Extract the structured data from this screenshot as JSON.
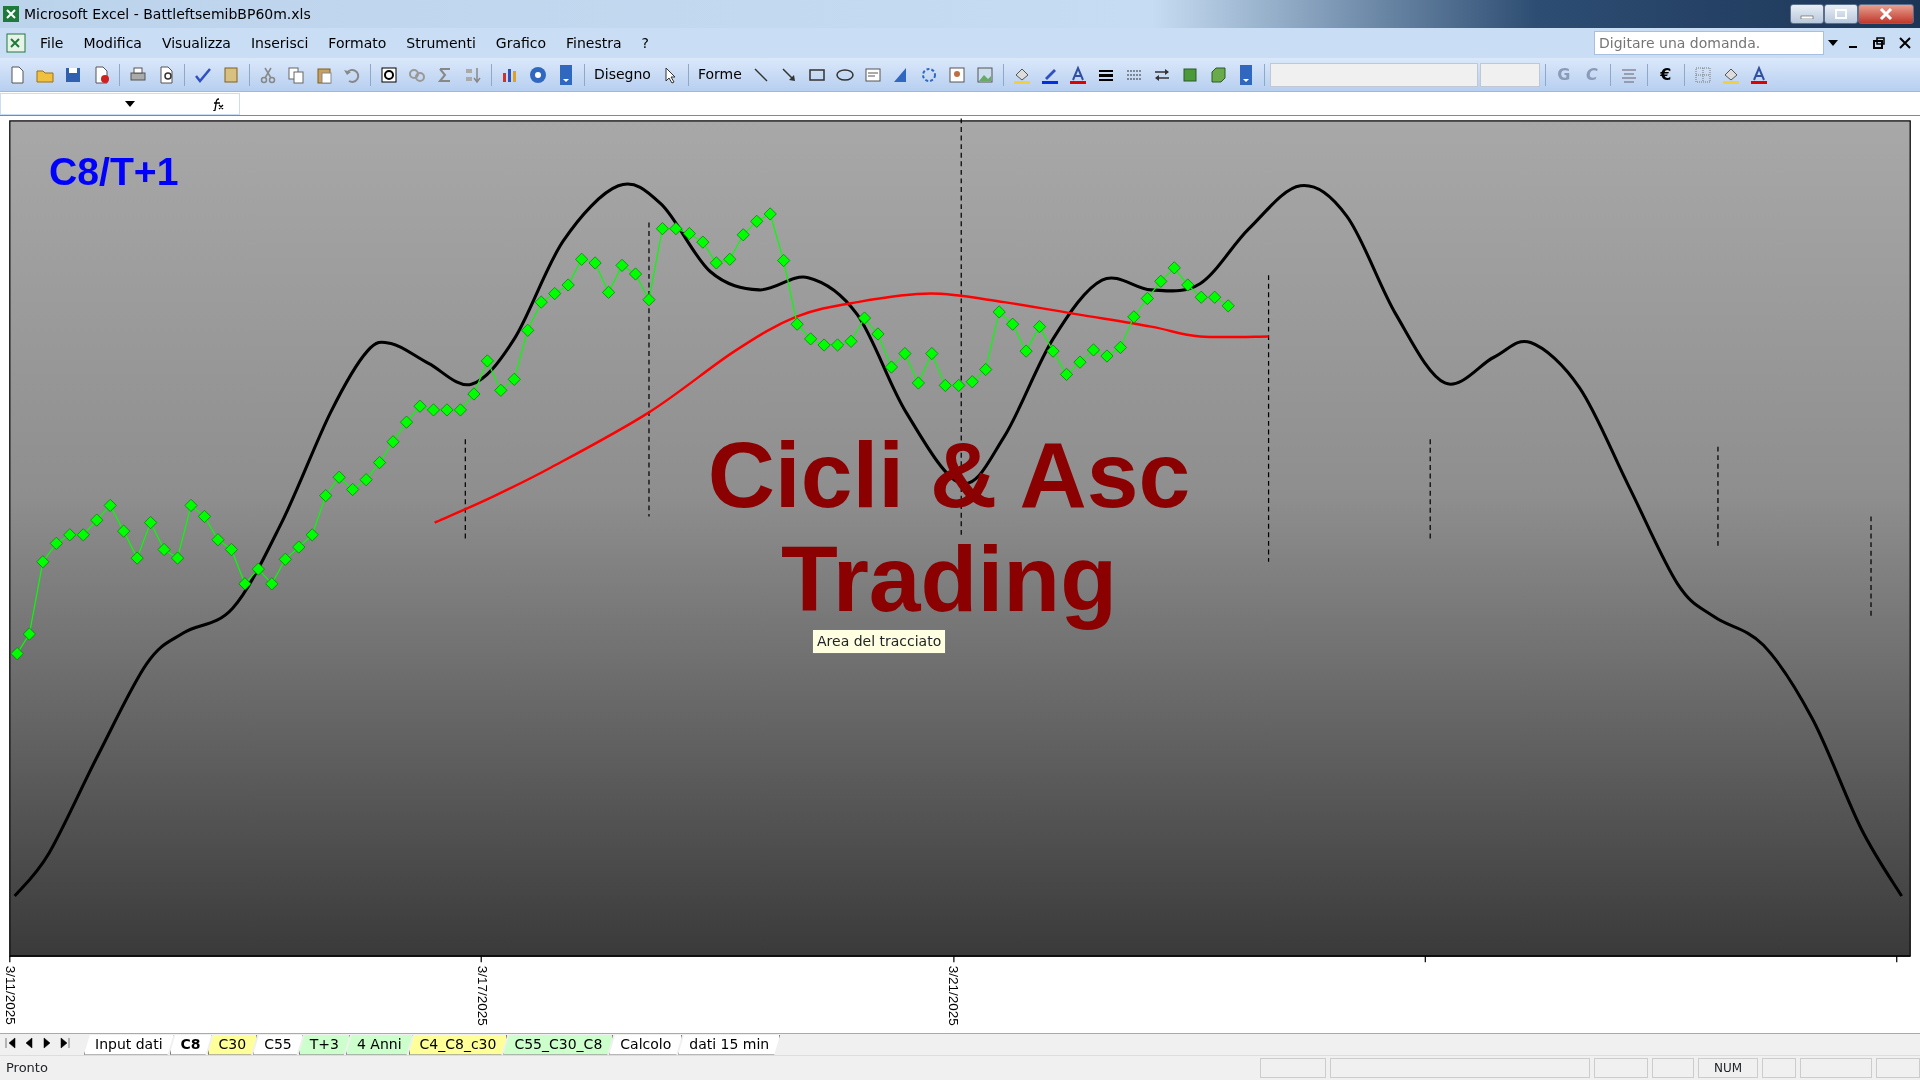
{
  "window": {
    "title": "Microsoft Excel - BattleftsemibBP60m.xls"
  },
  "menu": [
    "File",
    "Modifica",
    "Visualizza",
    "Inserisci",
    "Formato",
    "Strumenti",
    "Grafico",
    "Finestra",
    "?"
  ],
  "help_search": {
    "placeholder": "Digitare una domanda."
  },
  "toolbar": {
    "draw_menu": "Disegno",
    "shapes_menu": "Forme",
    "bold_button": "G",
    "italic_button": "C",
    "euro_button": "€"
  },
  "chart": {
    "title": "C8/T+1",
    "overlay_lines": [
      "Cicli & Asc",
      "Trading"
    ],
    "x_labels": [
      "3/11/2025",
      "3/17/2025",
      "3/21/2025"
    ],
    "tooltip": "Area del tracciato"
  },
  "sheet_tabs": [
    {
      "label": "Input dati",
      "selected": false,
      "color": "#ffffff"
    },
    {
      "label": "C8",
      "selected": true,
      "color": "#ffffff"
    },
    {
      "label": "C30",
      "selected": false,
      "color": "#ffff99"
    },
    {
      "label": "C55",
      "selected": false,
      "color": "#ffffff"
    },
    {
      "label": "T+3",
      "selected": false,
      "color": "#ccffcc"
    },
    {
      "label": "4 Anni",
      "selected": false,
      "color": "#ccffcc"
    },
    {
      "label": "C4_C8_c30",
      "selected": false,
      "color": "#ffff99"
    },
    {
      "label": "C55_C30_C8",
      "selected": false,
      "color": "#ccffcc"
    },
    {
      "label": "Calcolo",
      "selected": false,
      "color": "#ffffff"
    },
    {
      "label": "dati 15 min",
      "selected": false,
      "color": "#ffffff"
    }
  ],
  "status_bar": {
    "text": "Pronto",
    "indicators": [
      "NUM"
    ]
  }
}
